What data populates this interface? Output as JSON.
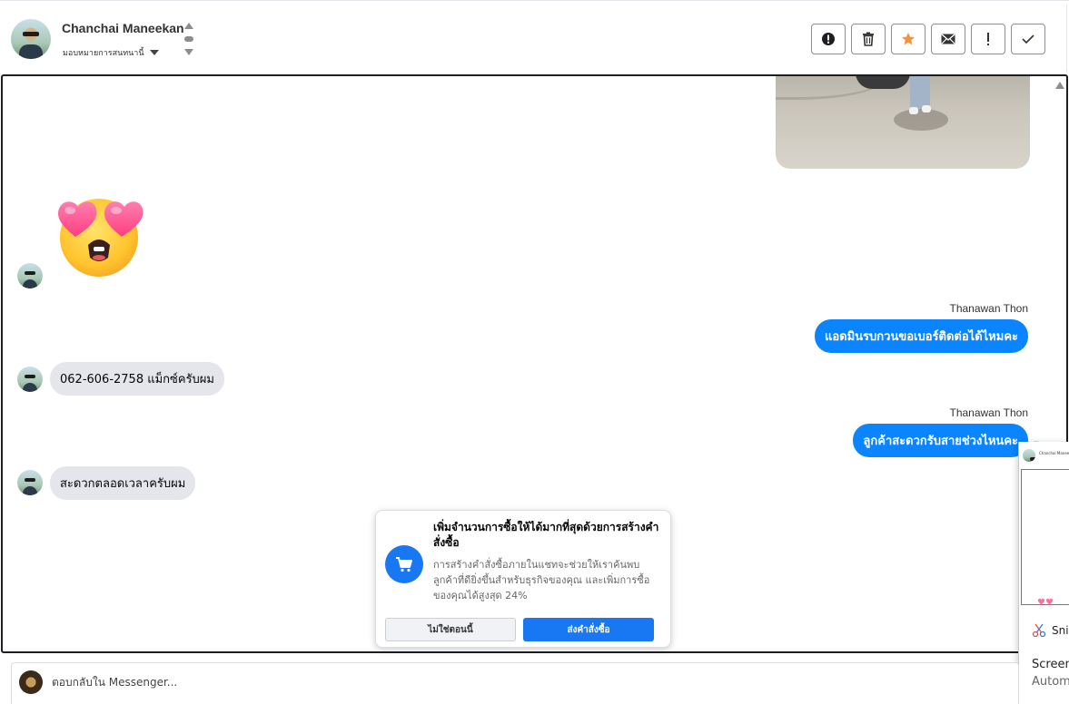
{
  "header": {
    "contact_name": "Chanchai Maneekan",
    "assign_label": "มอบหมายการสนทนานี้",
    "actions": [
      {
        "name": "report-spam",
        "icon": "alert-circle-icon"
      },
      {
        "name": "delete",
        "icon": "trash-icon"
      },
      {
        "name": "star",
        "icon": "star-icon",
        "color": "#f7923a"
      },
      {
        "name": "mark-unread",
        "icon": "envelope-icon"
      },
      {
        "name": "follow-up",
        "icon": "exclamation-icon"
      },
      {
        "name": "mark-done",
        "icon": "checkmark-icon"
      }
    ]
  },
  "messages": [
    {
      "direction": "in",
      "type": "sticker",
      "sticker": "heart-eyes-emoji"
    },
    {
      "direction": "out",
      "sender": "Thanawan Thon",
      "text": "แอดมินรบกวนขอเบอร์ติดต่อได้ไหมคะ"
    },
    {
      "direction": "in",
      "text": "062-606-2758 แม็กซ์ครับผม"
    },
    {
      "direction": "out",
      "sender": "Thanawan Thon",
      "text": "ลูกค้าสะดวกรับสายช่วงไหนคะ"
    },
    {
      "direction": "in",
      "text": "สะดวกตลอดเวลาครับผม"
    }
  ],
  "promo": {
    "title": "เพิ่มจำนวนการซื้อให้ได้มากที่สุดด้วยการสร้างคำสั่งซื้อ",
    "body": "การสร้างคำสั่งซื้อภายในแชทจะช่วยให้เราค้นพบลูกค้าที่ดียิ่งขึ้นสำหรับธุรกิจของคุณ และเพิ่มการซื้อของคุณได้สูงสุด 24%",
    "secondary_button": "ไม่ใช่ตอนนี้",
    "primary_button": "ส่งคำสั่งซื้อ",
    "icon": "cart-icon"
  },
  "snip": {
    "thumb_name": "Chanchai Maneek",
    "app_label": "Sni",
    "line1": "Screen",
    "line2": "Autom"
  },
  "composer": {
    "placeholder": "ตอบกลับใน Messenger..."
  },
  "colors": {
    "outgoing_bubble": "#0b84ff",
    "incoming_bubble": "#e4e6eb",
    "primary": "#1877f2",
    "star": "#f7923a"
  }
}
